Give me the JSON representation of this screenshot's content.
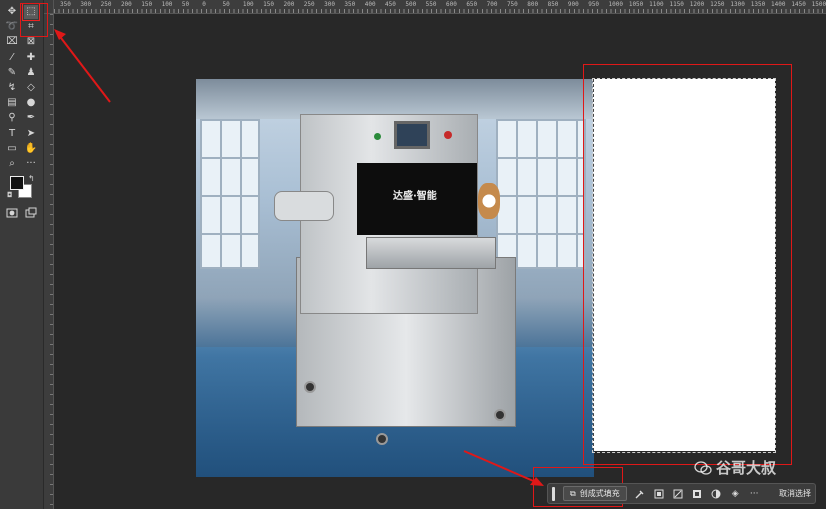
{
  "ruler": {
    "top_marks": [
      "350",
      "300",
      "250",
      "200",
      "150",
      "100",
      "50",
      "0",
      "50",
      "100",
      "150",
      "200",
      "250",
      "300",
      "350",
      "400",
      "450",
      "500",
      "550",
      "600",
      "650",
      "700",
      "750",
      "800",
      "850",
      "900",
      "950",
      "1000",
      "1050",
      "1100",
      "1150",
      "1200",
      "1250",
      "1300",
      "1350",
      "1400",
      "1450",
      "1500"
    ]
  },
  "toolbar": {
    "tools": [
      [
        "move-icon",
        "marquee-icon"
      ],
      [
        "lasso-icon",
        "object-select-icon"
      ],
      [
        "crop-icon",
        "frame-icon"
      ],
      [
        "eyedropper-icon",
        "healing-brush-icon"
      ],
      [
        "brush-icon",
        "stamp-icon"
      ],
      [
        "history-brush-icon",
        "eraser-icon"
      ],
      [
        "gradient-icon",
        "blur-icon"
      ],
      [
        "dodge-icon",
        "pen-icon"
      ],
      [
        "type-icon",
        "path-select-icon"
      ],
      [
        "rectangle-icon",
        "hand-icon"
      ],
      [
        "zoom-icon",
        "more-tools-icon"
      ]
    ],
    "active_tool": "marquee-icon"
  },
  "colors": {
    "foreground": "#111111",
    "background": "#ffffff",
    "annotation": "#e01818"
  },
  "image_text": {
    "brand": "达盛·智能"
  },
  "taskbar": {
    "generative_fill_label": "创成式填充",
    "deselect_label": "取消选择"
  },
  "watermark": {
    "text": "谷哥大叔"
  }
}
